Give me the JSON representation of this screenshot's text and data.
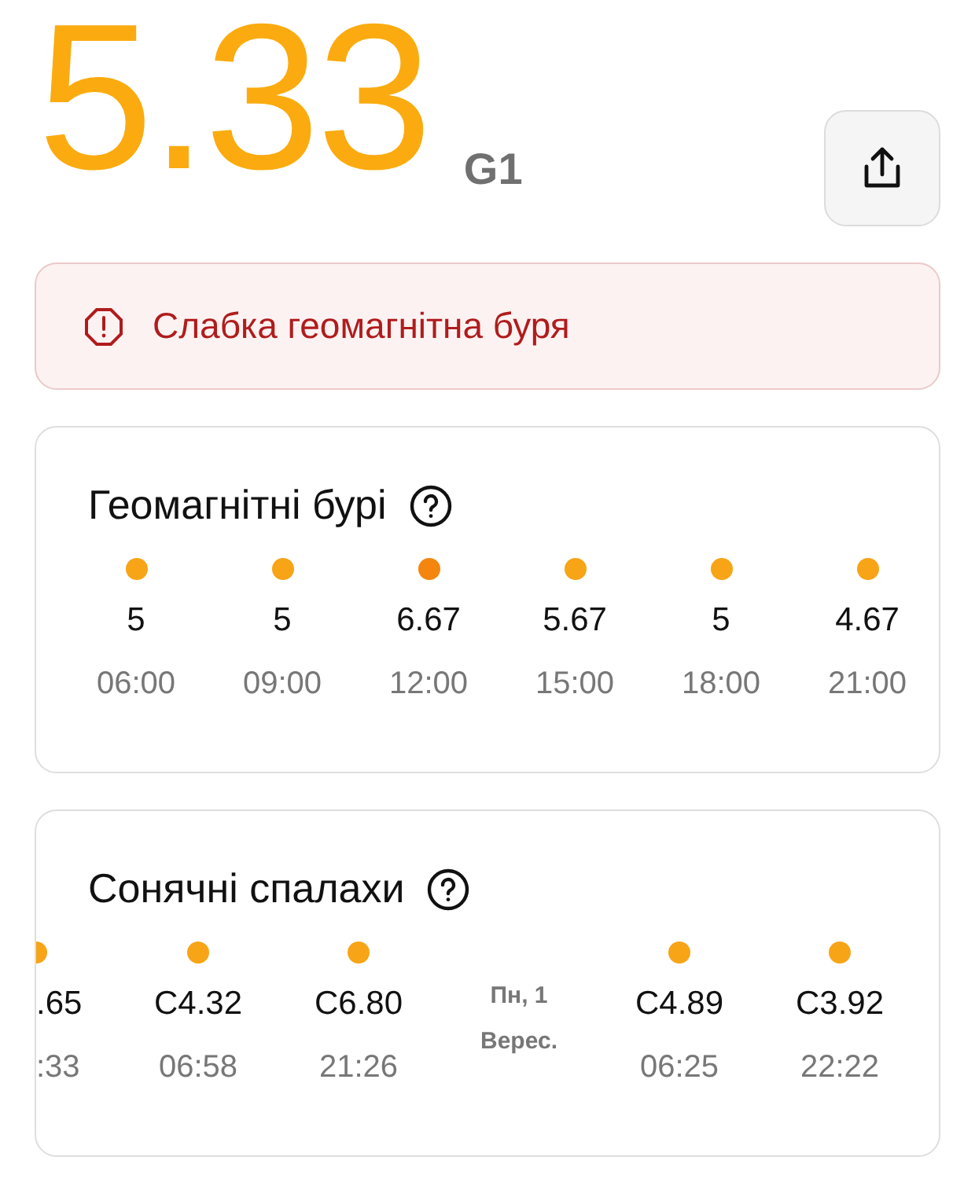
{
  "index": {
    "value": "5.33",
    "scale": "G1"
  },
  "alert": {
    "text": "Слабка геомагнітна буря"
  },
  "storms": {
    "title": "Геомагнітні бурі",
    "items": [
      {
        "value": "5",
        "time": "06:00",
        "color": "#f7a416"
      },
      {
        "value": "5",
        "time": "09:00",
        "color": "#f7a416"
      },
      {
        "value": "6.67",
        "time": "12:00",
        "color": "#f4850f"
      },
      {
        "value": "5.67",
        "time": "15:00",
        "color": "#f7a416"
      },
      {
        "value": "5",
        "time": "18:00",
        "color": "#f7a416"
      },
      {
        "value": "4.67",
        "time": "21:00",
        "color": "#f7a416"
      }
    ]
  },
  "flares": {
    "title": "Сонячні спалахи",
    "items": [
      {
        "kind": "clipped",
        "value": ".65",
        "time": ":33",
        "color": "#f7a416"
      },
      {
        "kind": "flare",
        "value": "C4.32",
        "time": "06:58",
        "color": "#f7a416"
      },
      {
        "kind": "flare",
        "value": "C6.80",
        "time": "21:26",
        "color": "#f7a416"
      },
      {
        "kind": "date",
        "day": "Пн, 1",
        "month": "Верес."
      },
      {
        "kind": "flare",
        "value": "C4.89",
        "time": "06:25",
        "color": "#f7a416"
      },
      {
        "kind": "flare",
        "value": "C3.92",
        "time": "22:22",
        "color": "#f7a416"
      }
    ]
  }
}
